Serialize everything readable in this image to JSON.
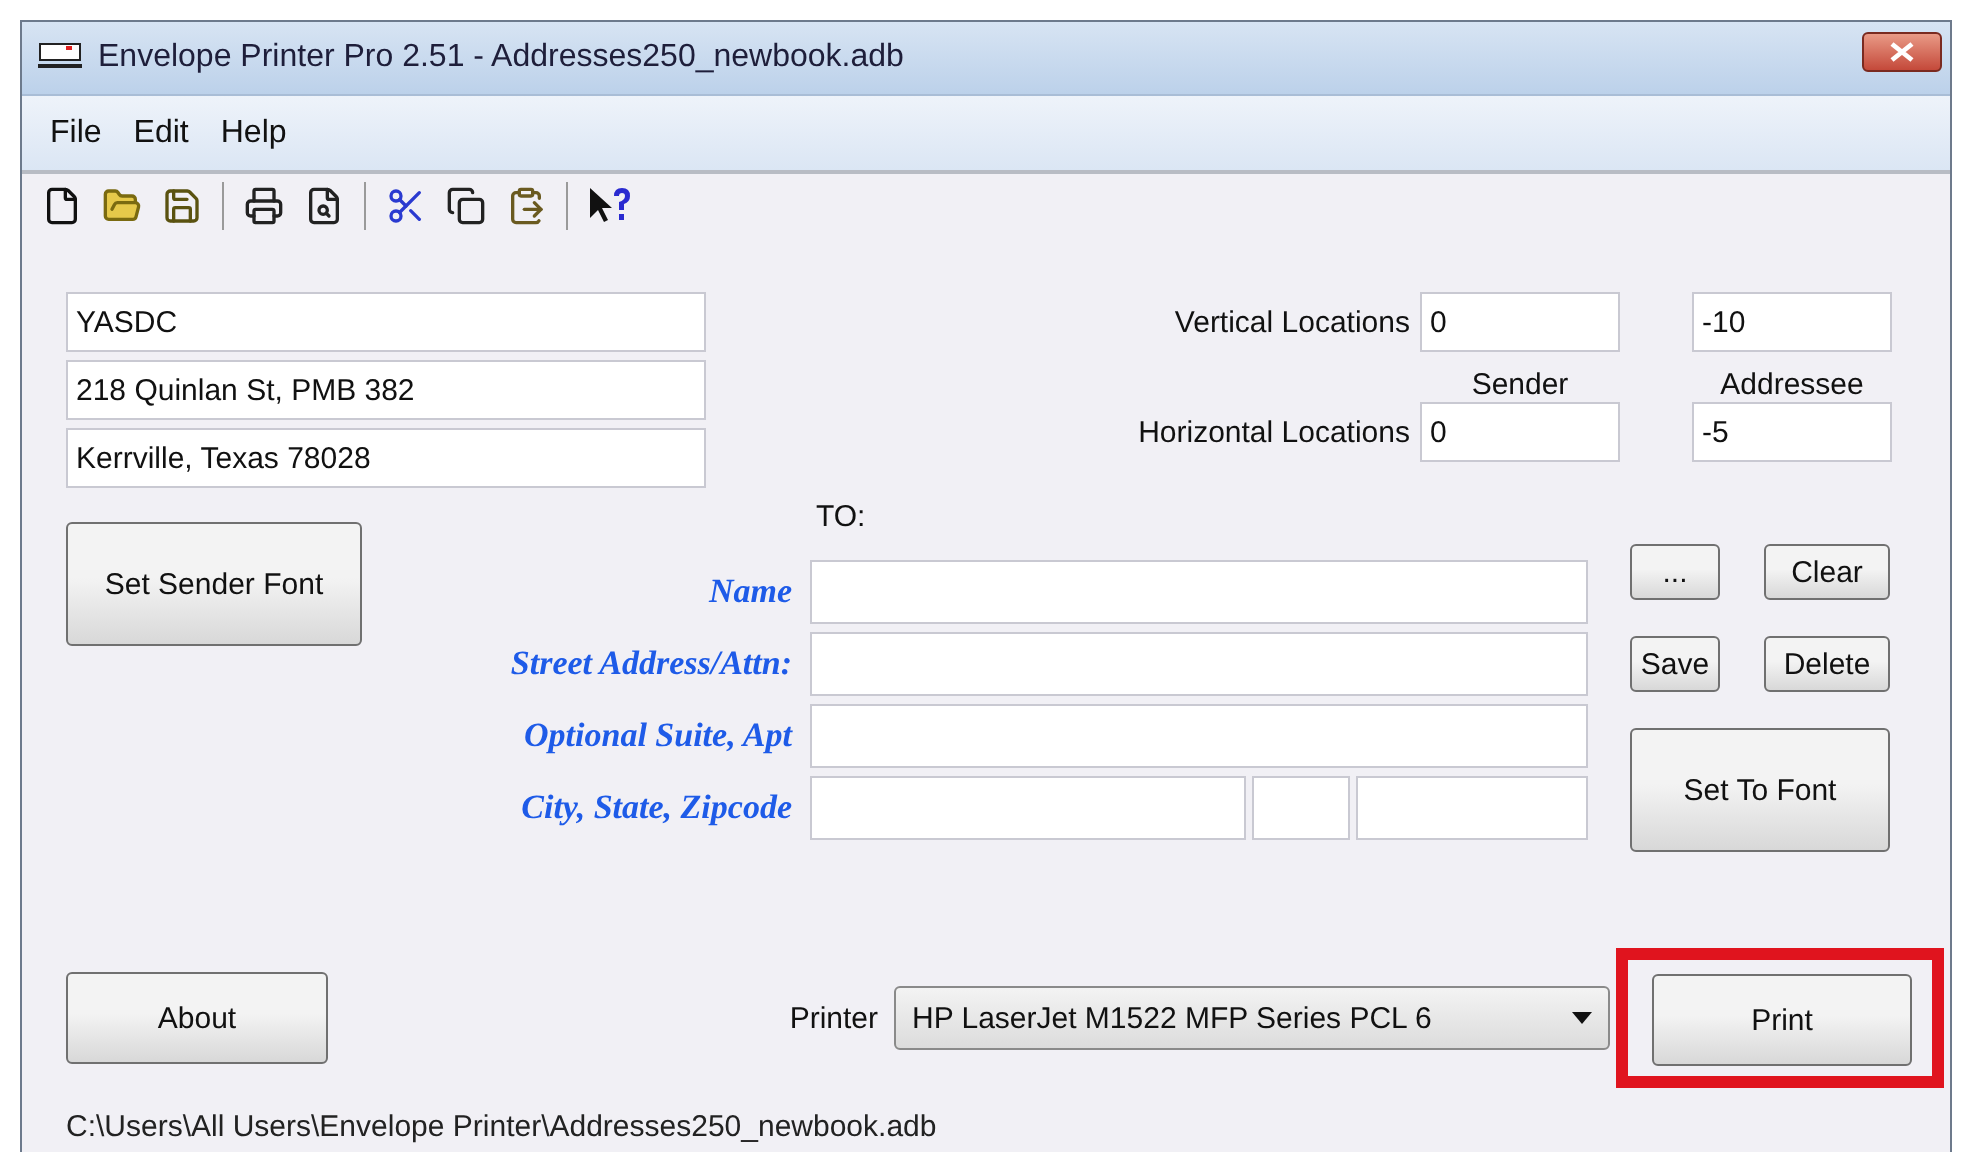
{
  "window": {
    "title": "Envelope Printer Pro 2.51 - Addresses250_newbook.adb"
  },
  "menu": [
    "File",
    "Edit",
    "Help"
  ],
  "sender": {
    "lines": [
      "YASDC",
      "218 Quinlan St, PMB 382",
      "Kerrville, Texas 78028"
    ],
    "font_button": "Set Sender Font"
  },
  "locations": {
    "vertical_label": "Vertical Locations",
    "horizontal_label": "Horizontal Locations",
    "sender_header": "Sender",
    "addressee_header": "Addressee",
    "vertical": {
      "sender": "0",
      "addressee": "-10"
    },
    "horizontal": {
      "sender": "0",
      "addressee": "-5"
    }
  },
  "recipient": {
    "heading": "TO:",
    "rows": [
      {
        "label": "Name",
        "kind": "single"
      },
      {
        "label": "Street Address/Attn:",
        "kind": "single"
      },
      {
        "label": "Optional Suite, Apt",
        "kind": "single"
      },
      {
        "label": "City, State, Zipcode",
        "kind": "split"
      }
    ]
  },
  "side_buttons": [
    "...",
    "Clear",
    "Save",
    "Delete"
  ],
  "to_font_button": "Set To Font",
  "about_button": "About",
  "printer": {
    "label": "Printer",
    "value": "HP LaserJet M1522 MFP Series PCL 6"
  },
  "print_button": {
    "label": "Print",
    "highlighted": true
  },
  "status_path": "C:\\Users\\All Users\\Envelope Printer\\Addresses250_newbook.adb"
}
